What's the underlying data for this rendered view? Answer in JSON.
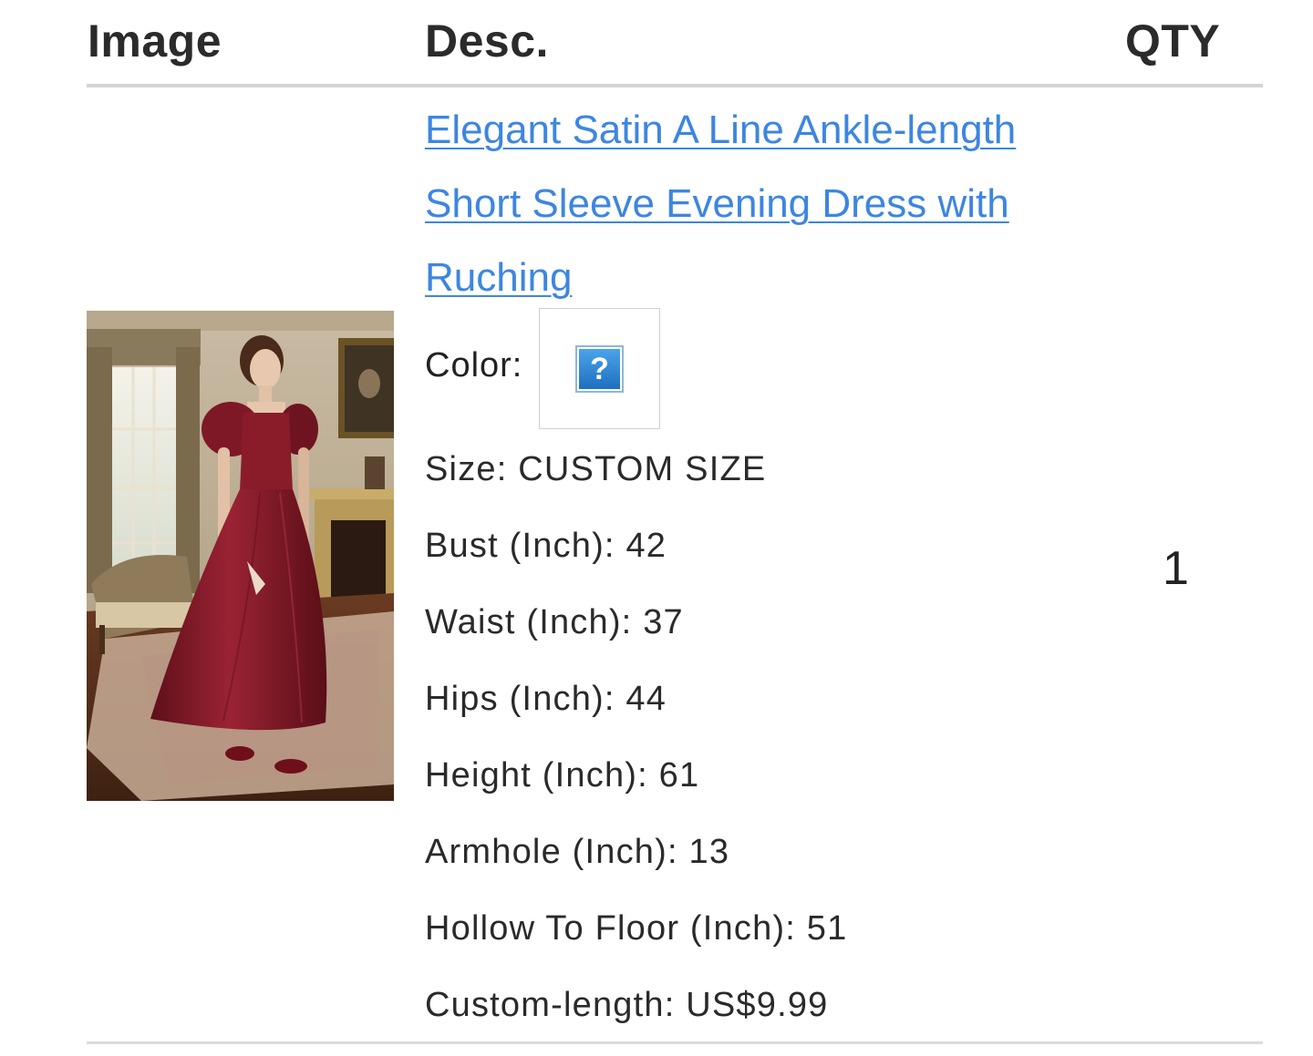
{
  "table": {
    "headers": {
      "image": "Image",
      "description": "Desc.",
      "quantity": "QTY"
    }
  },
  "item": {
    "title": "Elegant Satin A Line Ankle-length Short Sleeve Evening Dress with Ruching",
    "color": {
      "label": "Color:",
      "swatch_icon": "missing-image-icon",
      "swatch_glyph": "?"
    },
    "specs": [
      "Size: CUSTOM SIZE",
      "Bust (Inch): 42",
      "Waist (Inch): 37",
      "Hips (Inch): 44",
      "Height (Inch): 61",
      "Armhole (Inch): 13",
      "Hollow To Floor (Inch): 51",
      "Custom-length: US$9.99"
    ],
    "quantity": "1"
  },
  "colors": {
    "link": "#3d86e0",
    "divider": "#d4d4d4",
    "dress": "#8c1c2a"
  }
}
